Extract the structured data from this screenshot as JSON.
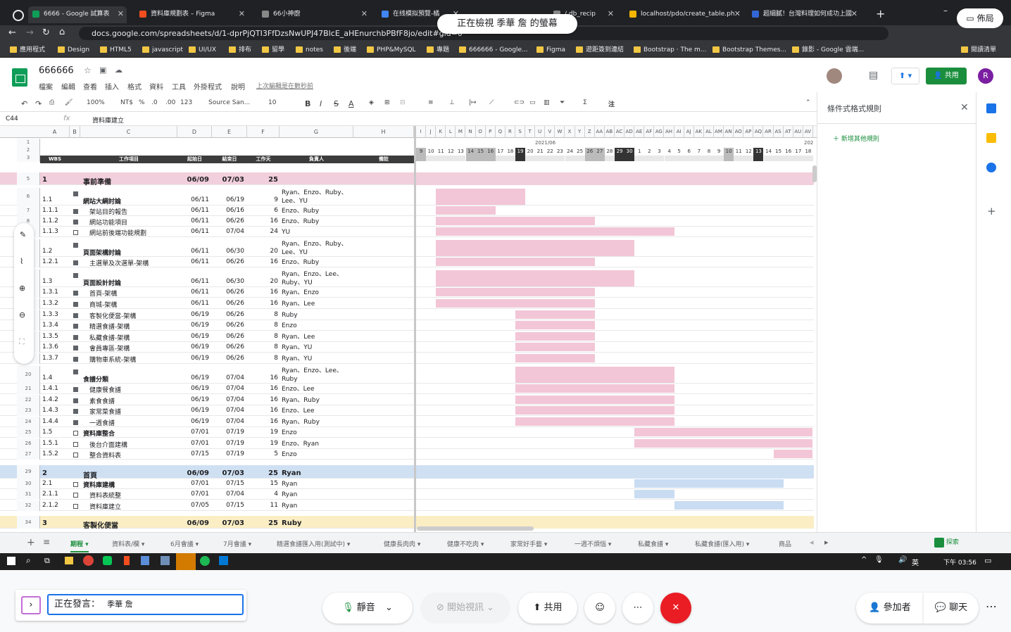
{
  "browser": {
    "tabs": [
      {
        "label": "6666 - Google 試算表",
        "color": "#0f9d58"
      },
      {
        "label": "資料庫規劃表 – Figma",
        "color": "#f24e1e"
      },
      {
        "label": "66小神廚",
        "color": "#888888"
      },
      {
        "label": "在线模拟預覽-橘",
        "color": "#4285f4"
      },
      {
        "label": "/ db_recip",
        "color": "#888888"
      },
      {
        "label": "localhost/pdo/create_table.ph",
        "color": "#f4b400"
      },
      {
        "label": "超細膩！台灣料理如何成功上國",
        "color": "#3367d6"
      }
    ],
    "url": "docs.google.com/spreadsheets/d/1-dprPjQTI3FfDzsNwUPJ47BlcE_aHEnurchbPBfF8jo/edit#gid=0",
    "bookmarks": [
      "應用程式",
      "Design",
      "HTML5",
      "javascript",
      "UI/UX",
      "排布",
      "留學",
      "notes",
      "後端",
      "PHP&MySQL",
      "專題",
      "666666 - Google...",
      "Figma",
      "遊距簽到連結",
      "Bootstrap · The m...",
      "Bootstrap Themes...",
      "錄影 - Google 雲端...",
      "閱讀清單"
    ],
    "viewing_banner": "正在檢視 季華 詹 的螢幕",
    "layout_button": "佈局"
  },
  "sheets": {
    "doc_name": "666666",
    "menus": [
      "檔案",
      "編輯",
      "查看",
      "插入",
      "格式",
      "資料",
      "工具",
      "外掛程式",
      "說明"
    ],
    "last_edit": "上次編輯是在數秒前",
    "share_label": "共用",
    "avatar_letter": "R",
    "toolbar": {
      "zoom": "100%",
      "currency": "NT$",
      "percent": "%",
      "dec0": ".0",
      "dec00": ".00",
      "fmt": "123",
      "font": "Source San...",
      "size": "10",
      "bold": "B",
      "italic": "I",
      "strike": "S",
      "color": "A",
      "notes": "注"
    },
    "cell_ref": "C44",
    "fx": "fx",
    "formula": "資料庫建立",
    "cols": [
      "A",
      "B",
      "C",
      "D",
      "E",
      "F",
      "G",
      "H"
    ],
    "gantt_cols": [
      "I",
      "J",
      "K",
      "L",
      "M",
      "N",
      "O",
      "P",
      "Q",
      "R",
      "S",
      "T",
      "U",
      "V",
      "W",
      "X",
      "Y",
      "Z",
      "AA",
      "AB",
      "AC",
      "AD",
      "AE",
      "AF",
      "AG",
      "AH",
      "AI",
      "AJ",
      "AK",
      "AL",
      "AM",
      "AN",
      "AO",
      "AP",
      "AQ",
      "AR",
      "AS",
      "AT",
      "AU",
      "AV"
    ],
    "month_label": "2021/06",
    "year_label": "202",
    "days": [
      "9",
      "10",
      "11",
      "12",
      "13",
      "14",
      "15",
      "16",
      "17",
      "18",
      "19",
      "20",
      "21",
      "22",
      "23",
      "24",
      "25",
      "26",
      "27",
      "28",
      "29",
      "30",
      "1",
      "2",
      "3",
      "4",
      "5",
      "6",
      "7",
      "8",
      "9",
      "10",
      "11",
      "12",
      "13",
      "14",
      "15",
      "16",
      "17",
      "18"
    ],
    "headers": {
      "wbs": "WBS",
      "item": "工作項目",
      "start": "起始日",
      "end": "結束日",
      "days": "工作天",
      "owner": "負責人",
      "note": "備註"
    },
    "rows": [
      {
        "n": "5",
        "wbs": "1",
        "item": "事前準備",
        "start": "06/09",
        "end": "07/03",
        "d": "25",
        "owner": "",
        "type": "section",
        "color": "#f2cfdc",
        "cb": ""
      },
      {
        "n": "6",
        "wbs": "1.1",
        "item": "網站大綱討論",
        "start": "06/11",
        "end": "06/19",
        "d": "9",
        "owner": "Ryan、Enzo、Ruby、Lee、YU",
        "type": "group",
        "cb": "on"
      },
      {
        "n": "7",
        "wbs": "1.1.1",
        "item": "架站目的報告",
        "start": "06/11",
        "end": "06/16",
        "d": "6",
        "owner": "Enzo、Ruby",
        "type": "task",
        "cb": "on"
      },
      {
        "n": "8",
        "wbs": "1.1.2",
        "item": "網站功能項目",
        "start": "06/11",
        "end": "06/26",
        "d": "16",
        "owner": "Enzo、Ruby",
        "type": "task",
        "cb": "on"
      },
      {
        "n": "9",
        "wbs": "1.1.3",
        "item": "網站前後端功能規劃",
        "start": "06/11",
        "end": "07/04",
        "d": "24",
        "owner": "YU",
        "type": "task",
        "cb": "off"
      },
      {
        "n": "10",
        "wbs": "1.2",
        "item": "頁面架構討論",
        "start": "06/11",
        "end": "06/30",
        "d": "20",
        "owner": "Ryan、Enzo、Ruby、Lee、YU",
        "type": "group",
        "cb": "on"
      },
      {
        "n": "11",
        "wbs": "1.2.1",
        "item": "主選單及次選單-架構",
        "start": "06/11",
        "end": "06/26",
        "d": "16",
        "owner": "Enzo、Ruby",
        "type": "task",
        "cb": "on"
      },
      {
        "n": "12",
        "wbs": "1.3",
        "item": "頁面設計討論",
        "start": "06/11",
        "end": "06/30",
        "d": "20",
        "owner": "Ryan、Enzo、Lee、Ruby、YU",
        "type": "group",
        "cb": "on"
      },
      {
        "n": "13",
        "wbs": "1.3.1",
        "item": "首頁-架構",
        "start": "06/11",
        "end": "06/26",
        "d": "16",
        "owner": "Ryan、Enzo",
        "type": "task",
        "cb": "on"
      },
      {
        "n": "14",
        "wbs": "1.3.2",
        "item": "商城-架構",
        "start": "06/11",
        "end": "06/26",
        "d": "16",
        "owner": "Ryan、Lee",
        "type": "task",
        "cb": "on"
      },
      {
        "n": "15",
        "wbs": "1.3.3",
        "item": "客製化便當-架構",
        "start": "06/19",
        "end": "06/26",
        "d": "8",
        "owner": "Ruby",
        "type": "task",
        "cb": "on"
      },
      {
        "n": "16",
        "wbs": "1.3.4",
        "item": "精選食譜-架構",
        "start": "06/19",
        "end": "06/26",
        "d": "8",
        "owner": "Enzo",
        "type": "task",
        "cb": "on"
      },
      {
        "n": "17",
        "wbs": "1.3.5",
        "item": "私藏食譜-架構",
        "start": "06/19",
        "end": "06/26",
        "d": "8",
        "owner": "Ryan、Lee",
        "type": "task",
        "cb": "on"
      },
      {
        "n": "18",
        "wbs": "1.3.6",
        "item": "會員專區-架構",
        "start": "06/19",
        "end": "06/26",
        "d": "8",
        "owner": "Ryan、YU",
        "type": "task",
        "cb": "on"
      },
      {
        "n": "19",
        "wbs": "1.3.7",
        "item": "購物車系統-架構",
        "start": "06/19",
        "end": "06/26",
        "d": "8",
        "owner": "Ryan、YU",
        "type": "task",
        "cb": "on"
      },
      {
        "n": "20",
        "wbs": "1.4",
        "item": "食譜分類",
        "start": "06/19",
        "end": "07/04",
        "d": "16",
        "owner": "Ryan、Enzo、Lee、Ruby",
        "type": "group",
        "cb": "on"
      },
      {
        "n": "21",
        "wbs": "1.4.1",
        "item": "健康餐食譜",
        "start": "06/19",
        "end": "07/04",
        "d": "16",
        "owner": "Enzo、Lee",
        "type": "task",
        "cb": "on"
      },
      {
        "n": "22",
        "wbs": "1.4.2",
        "item": "素食食譜",
        "start": "06/19",
        "end": "07/04",
        "d": "16",
        "owner": "Ryan、Ruby",
        "type": "task",
        "cb": "on"
      },
      {
        "n": "23",
        "wbs": "1.4.3",
        "item": "家常菜食譜",
        "start": "06/19",
        "end": "07/04",
        "d": "16",
        "owner": "Enzo、Lee",
        "type": "task",
        "cb": "on"
      },
      {
        "n": "24",
        "wbs": "1.4.4",
        "item": "一週食譜",
        "start": "06/19",
        "end": "07/04",
        "d": "16",
        "owner": "Ryan、Ruby",
        "type": "task",
        "cb": "on"
      },
      {
        "n": "25",
        "wbs": "1.5",
        "item": "資料庫整合",
        "start": "07/01",
        "end": "07/19",
        "d": "19",
        "owner": "Enzo",
        "type": "group1",
        "cb": "off"
      },
      {
        "n": "26",
        "wbs": "1.5.1",
        "item": "後台介面建構",
        "start": "07/01",
        "end": "07/19",
        "d": "19",
        "owner": "Enzo、Ryan",
        "type": "task",
        "cb": "off"
      },
      {
        "n": "27",
        "wbs": "1.5.2",
        "item": "整合資料表",
        "start": "07/15",
        "end": "07/19",
        "d": "5",
        "owner": "Enzo",
        "type": "task",
        "cb": "off"
      },
      {
        "n": "29",
        "wbs": "2",
        "item": "首頁",
        "start": "06/09",
        "end": "07/03",
        "d": "25",
        "owner": "Ryan",
        "type": "section",
        "color": "#cfe0f3",
        "cb": ""
      },
      {
        "n": "30",
        "wbs": "2.1",
        "item": "資料庫建構",
        "start": "07/01",
        "end": "07/15",
        "d": "15",
        "owner": "Ryan",
        "type": "group1",
        "cb": "off"
      },
      {
        "n": "31",
        "wbs": "2.1.1",
        "item": "資料表統整",
        "start": "07/01",
        "end": "07/04",
        "d": "4",
        "owner": "Ryan",
        "type": "task",
        "cb": "off"
      },
      {
        "n": "32",
        "wbs": "2.1.2",
        "item": "資料庫建立",
        "start": "07/05",
        "end": "07/15",
        "d": "11",
        "owner": "Ryan",
        "type": "task",
        "cb": "off"
      },
      {
        "n": "34",
        "wbs": "3",
        "item": "客製化便當",
        "start": "06/09",
        "end": "07/03",
        "d": "25",
        "owner": "Ruby",
        "type": "section",
        "color": "#fbeec4",
        "cb": ""
      }
    ],
    "side_panel": {
      "title": "條件式格式規則",
      "add_rule": "新增其他規則"
    },
    "sheet_tabs": [
      "期程",
      "資料表/欄",
      "6月會議",
      "7月會議",
      "精選食譜匯入用(測試中)",
      "健康長肉肉",
      "健康不吃肉",
      "家常好手藝",
      "一週不煩惱",
      "私藏食譜",
      "私藏食譜(匯入用)",
      "商品"
    ],
    "explore": "探索"
  },
  "taskbar": {
    "ime": "英",
    "time": "下午 03:56"
  },
  "meet": {
    "speaking_label": "正在發言：",
    "speaker": "季華 詹",
    "mute": "靜音",
    "video": "開始視訊",
    "share": "共用",
    "participants": "參加者",
    "chat": "聊天"
  }
}
